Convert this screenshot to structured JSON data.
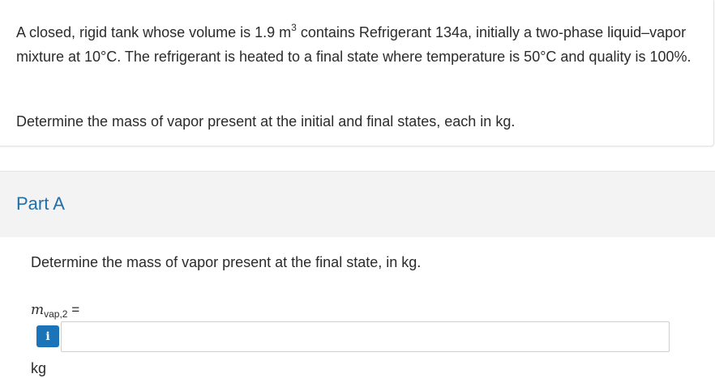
{
  "problem": {
    "statement_part1": "A closed, rigid tank whose volume is 1.9 m",
    "statement_sup": "3",
    "statement_part2": "contains Refrigerant 134a, initially a two-phase liquid–vapor mixture at 10°C. The refrigerant is heated to a final state where temperature is 50°C and quality is 100%.",
    "question": "Determine the mass of vapor present at the initial and final states, each in kg."
  },
  "part": {
    "title": "Part A",
    "question": "Determine the mass of vapor present at the final state, in kg.",
    "variable_symbol": "m",
    "variable_subscript": "vap,2",
    "equals": " =",
    "info_icon_glyph": "i",
    "input_value": "",
    "unit": "kg"
  },
  "colors": {
    "accent_blue": "#1c74b8",
    "part_title_blue": "#1f6fa8",
    "part_header_bg": "#f3f3f3"
  }
}
